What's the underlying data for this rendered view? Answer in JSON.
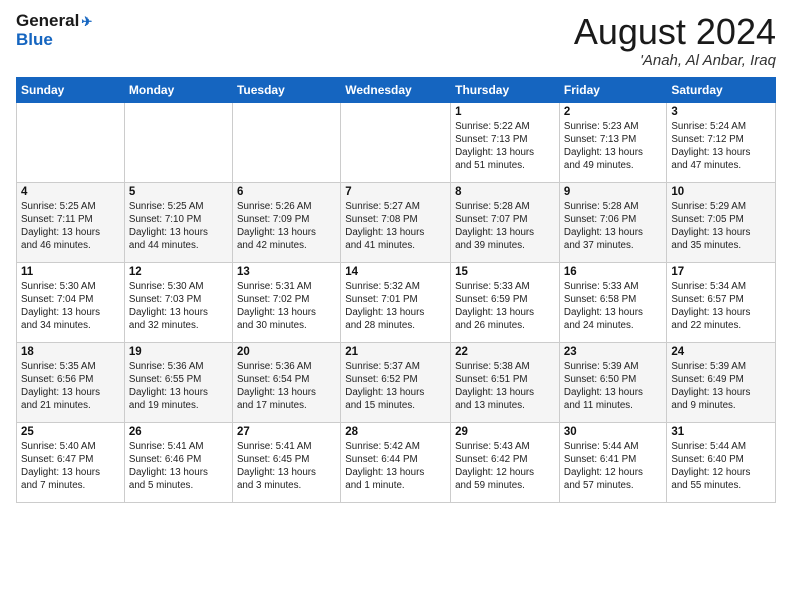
{
  "header": {
    "logo_line1": "General",
    "logo_line2": "Blue",
    "month": "August 2024",
    "location": "'Anah, Al Anbar, Iraq"
  },
  "weekdays": [
    "Sunday",
    "Monday",
    "Tuesday",
    "Wednesday",
    "Thursday",
    "Friday",
    "Saturday"
  ],
  "weeks": [
    [
      {
        "day": "",
        "info": ""
      },
      {
        "day": "",
        "info": ""
      },
      {
        "day": "",
        "info": ""
      },
      {
        "day": "",
        "info": ""
      },
      {
        "day": "1",
        "info": "Sunrise: 5:22 AM\nSunset: 7:13 PM\nDaylight: 13 hours\nand 51 minutes."
      },
      {
        "day": "2",
        "info": "Sunrise: 5:23 AM\nSunset: 7:13 PM\nDaylight: 13 hours\nand 49 minutes."
      },
      {
        "day": "3",
        "info": "Sunrise: 5:24 AM\nSunset: 7:12 PM\nDaylight: 13 hours\nand 47 minutes."
      }
    ],
    [
      {
        "day": "4",
        "info": "Sunrise: 5:25 AM\nSunset: 7:11 PM\nDaylight: 13 hours\nand 46 minutes."
      },
      {
        "day": "5",
        "info": "Sunrise: 5:25 AM\nSunset: 7:10 PM\nDaylight: 13 hours\nand 44 minutes."
      },
      {
        "day": "6",
        "info": "Sunrise: 5:26 AM\nSunset: 7:09 PM\nDaylight: 13 hours\nand 42 minutes."
      },
      {
        "day": "7",
        "info": "Sunrise: 5:27 AM\nSunset: 7:08 PM\nDaylight: 13 hours\nand 41 minutes."
      },
      {
        "day": "8",
        "info": "Sunrise: 5:28 AM\nSunset: 7:07 PM\nDaylight: 13 hours\nand 39 minutes."
      },
      {
        "day": "9",
        "info": "Sunrise: 5:28 AM\nSunset: 7:06 PM\nDaylight: 13 hours\nand 37 minutes."
      },
      {
        "day": "10",
        "info": "Sunrise: 5:29 AM\nSunset: 7:05 PM\nDaylight: 13 hours\nand 35 minutes."
      }
    ],
    [
      {
        "day": "11",
        "info": "Sunrise: 5:30 AM\nSunset: 7:04 PM\nDaylight: 13 hours\nand 34 minutes."
      },
      {
        "day": "12",
        "info": "Sunrise: 5:30 AM\nSunset: 7:03 PM\nDaylight: 13 hours\nand 32 minutes."
      },
      {
        "day": "13",
        "info": "Sunrise: 5:31 AM\nSunset: 7:02 PM\nDaylight: 13 hours\nand 30 minutes."
      },
      {
        "day": "14",
        "info": "Sunrise: 5:32 AM\nSunset: 7:01 PM\nDaylight: 13 hours\nand 28 minutes."
      },
      {
        "day": "15",
        "info": "Sunrise: 5:33 AM\nSunset: 6:59 PM\nDaylight: 13 hours\nand 26 minutes."
      },
      {
        "day": "16",
        "info": "Sunrise: 5:33 AM\nSunset: 6:58 PM\nDaylight: 13 hours\nand 24 minutes."
      },
      {
        "day": "17",
        "info": "Sunrise: 5:34 AM\nSunset: 6:57 PM\nDaylight: 13 hours\nand 22 minutes."
      }
    ],
    [
      {
        "day": "18",
        "info": "Sunrise: 5:35 AM\nSunset: 6:56 PM\nDaylight: 13 hours\nand 21 minutes."
      },
      {
        "day": "19",
        "info": "Sunrise: 5:36 AM\nSunset: 6:55 PM\nDaylight: 13 hours\nand 19 minutes."
      },
      {
        "day": "20",
        "info": "Sunrise: 5:36 AM\nSunset: 6:54 PM\nDaylight: 13 hours\nand 17 minutes."
      },
      {
        "day": "21",
        "info": "Sunrise: 5:37 AM\nSunset: 6:52 PM\nDaylight: 13 hours\nand 15 minutes."
      },
      {
        "day": "22",
        "info": "Sunrise: 5:38 AM\nSunset: 6:51 PM\nDaylight: 13 hours\nand 13 minutes."
      },
      {
        "day": "23",
        "info": "Sunrise: 5:39 AM\nSunset: 6:50 PM\nDaylight: 13 hours\nand 11 minutes."
      },
      {
        "day": "24",
        "info": "Sunrise: 5:39 AM\nSunset: 6:49 PM\nDaylight: 13 hours\nand 9 minutes."
      }
    ],
    [
      {
        "day": "25",
        "info": "Sunrise: 5:40 AM\nSunset: 6:47 PM\nDaylight: 13 hours\nand 7 minutes."
      },
      {
        "day": "26",
        "info": "Sunrise: 5:41 AM\nSunset: 6:46 PM\nDaylight: 13 hours\nand 5 minutes."
      },
      {
        "day": "27",
        "info": "Sunrise: 5:41 AM\nSunset: 6:45 PM\nDaylight: 13 hours\nand 3 minutes."
      },
      {
        "day": "28",
        "info": "Sunrise: 5:42 AM\nSunset: 6:44 PM\nDaylight: 13 hours\nand 1 minute."
      },
      {
        "day": "29",
        "info": "Sunrise: 5:43 AM\nSunset: 6:42 PM\nDaylight: 12 hours\nand 59 minutes."
      },
      {
        "day": "30",
        "info": "Sunrise: 5:44 AM\nSunset: 6:41 PM\nDaylight: 12 hours\nand 57 minutes."
      },
      {
        "day": "31",
        "info": "Sunrise: 5:44 AM\nSunset: 6:40 PM\nDaylight: 12 hours\nand 55 minutes."
      }
    ]
  ]
}
